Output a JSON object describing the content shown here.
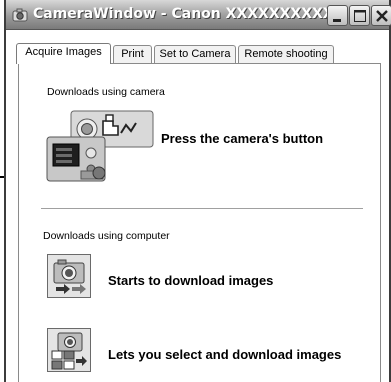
{
  "window": {
    "title": "CameraWindow - Canon XXXXXXXXXXX"
  },
  "tabs": [
    {
      "label": "Acquire Images",
      "active": true
    },
    {
      "label": "Print",
      "active": false
    },
    {
      "label": "Set to Camera",
      "active": false
    },
    {
      "label": "Remote shooting",
      "active": false
    }
  ],
  "camera_section": {
    "heading": "Downloads using camera",
    "action_label": "Press the camera's button",
    "icon": "camera-button-icon"
  },
  "computer_section": {
    "heading": "Downloads using computer",
    "actions": [
      {
        "label": "Starts to download images",
        "icon": "camera-download-icon"
      },
      {
        "label": "Lets you select and download images",
        "icon": "select-download-icon"
      }
    ]
  }
}
